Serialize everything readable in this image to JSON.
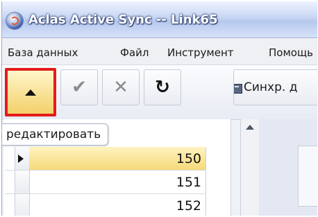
{
  "window": {
    "title": "Aclas Active Sync -- Link65"
  },
  "menu": {
    "items": [
      "База данных",
      "Файл",
      "Инструмент",
      "Помощь"
    ]
  },
  "toolbar": {
    "sync_label": "Синхр. д",
    "tooltip": "редактировать"
  },
  "grid": {
    "rows": [
      {
        "value": "150",
        "selected": true
      },
      {
        "value": "151",
        "selected": false
      },
      {
        "value": "152",
        "selected": false
      }
    ]
  },
  "colors": {
    "highlight": "#e21b1b",
    "selected_row": "#f6d97a",
    "title_bar": "#c8d6f3"
  }
}
